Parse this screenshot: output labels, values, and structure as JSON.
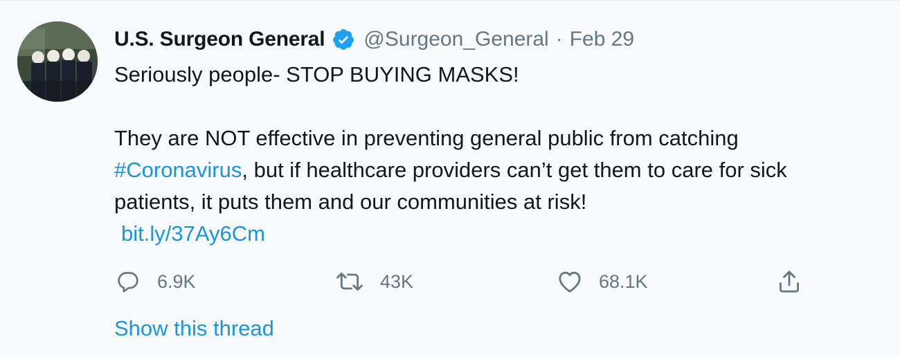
{
  "tweet": {
    "display_name": "U.S. Surgeon General",
    "handle": "@Surgeon_General",
    "separator": "·",
    "date": "Feb 29",
    "text": {
      "line1": "Seriously people- STOP BUYING MASKS!",
      "line2": "They are NOT effective in preventing general public from catching",
      "hashtag": "#Coronavirus",
      "line3_rest": ", but if healthcare providers can’t get them to care for sick",
      "line4": "patients, it puts them and our communities at risk!",
      "link": "bit.ly/37Ay6Cm"
    },
    "stats": {
      "replies": "6.9K",
      "retweets": "43K",
      "likes": "68.1K"
    },
    "show_thread": "Show this thread"
  },
  "icons": {
    "verified": "verified-badge-icon",
    "reply": "reply-icon",
    "retweet": "retweet-icon",
    "like": "heart-icon",
    "share": "share-icon"
  },
  "colors": {
    "accent": "#1b95e0",
    "muted": "#657786",
    "text": "#14171a",
    "background": "#f7f9fa"
  }
}
